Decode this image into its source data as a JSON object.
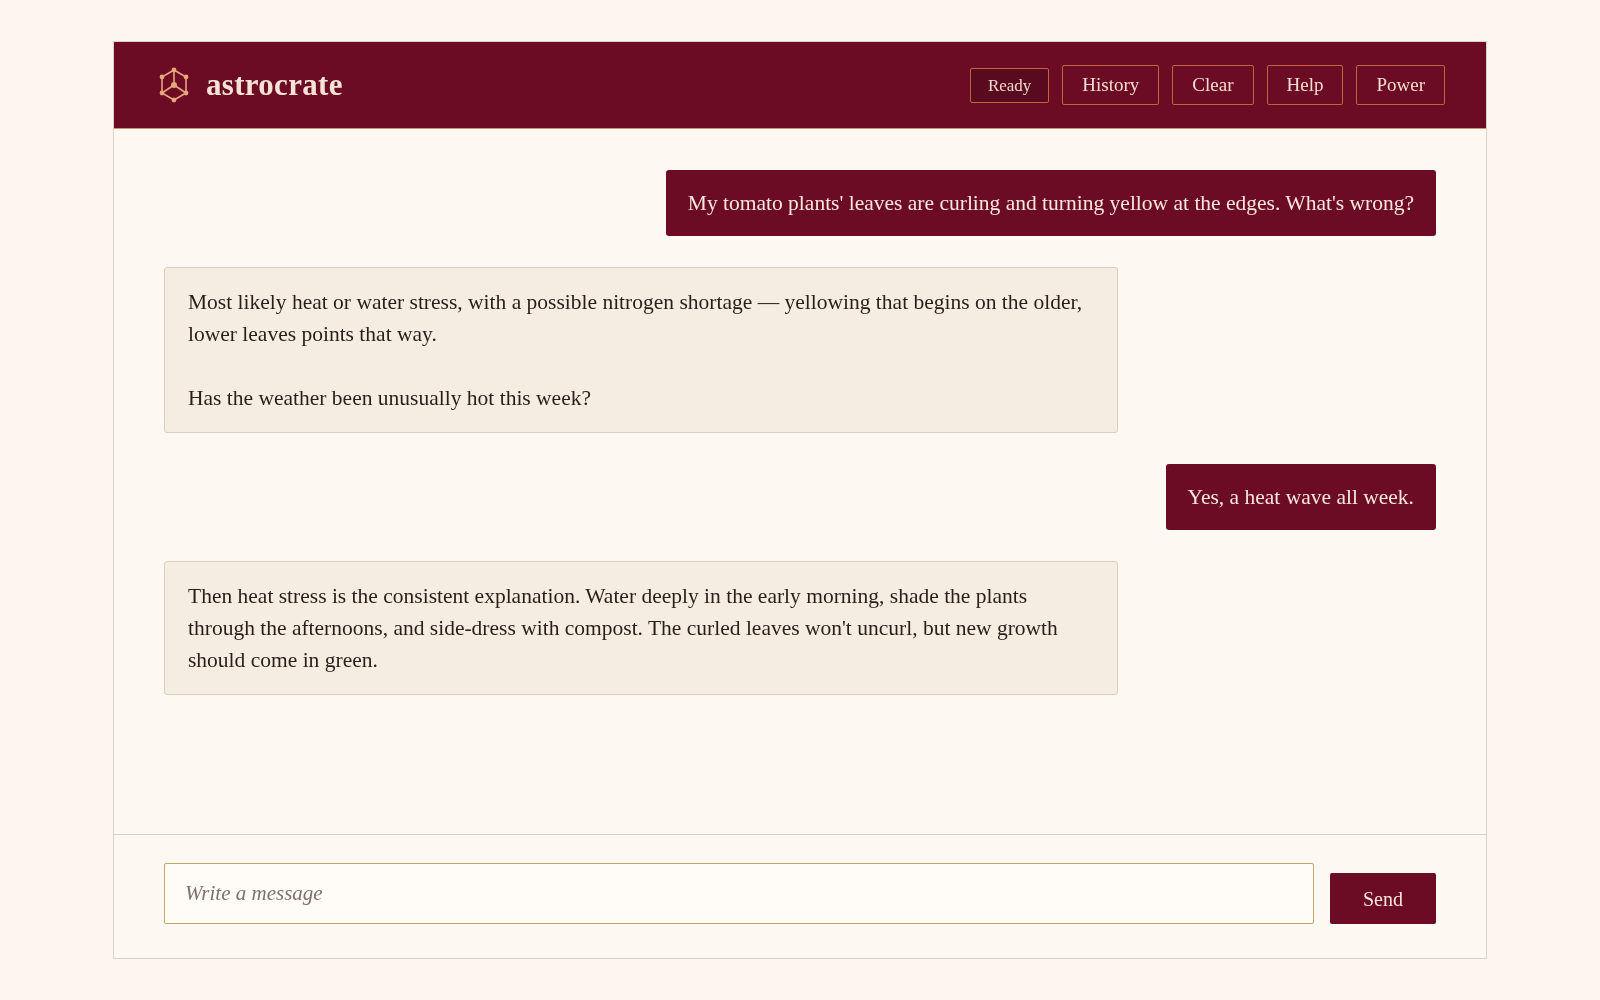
{
  "header": {
    "brand": "astrocrate",
    "status": {
      "label": "Ready"
    },
    "buttons": [
      "History",
      "Clear",
      "Help",
      "Power"
    ]
  },
  "messages": [
    {
      "kind": "user",
      "paragraphs": [
        "My tomato plants' leaves are curling and turning yellow at the edges. What's wrong?"
      ]
    },
    {
      "kind": "assistant",
      "paragraphs": [
        "Most likely heat or water stress, with a possible nitrogen shortage — yellowing that begins on the older, lower leaves points that way.",
        "Has the weather been unusually hot this week?"
      ]
    },
    {
      "kind": "user",
      "paragraphs": [
        "Yes, a heat wave all week."
      ]
    },
    {
      "kind": "assistant",
      "paragraphs": [
        "Then heat stress is the consistent explanation. Water deeply in the early morning, shade the plants through the afternoons, and side-dress with compost. The curled leaves won't uncurl, but new growth should come in green."
      ]
    }
  ],
  "composer": {
    "placeholder": "Write a message",
    "button": "Send"
  }
}
